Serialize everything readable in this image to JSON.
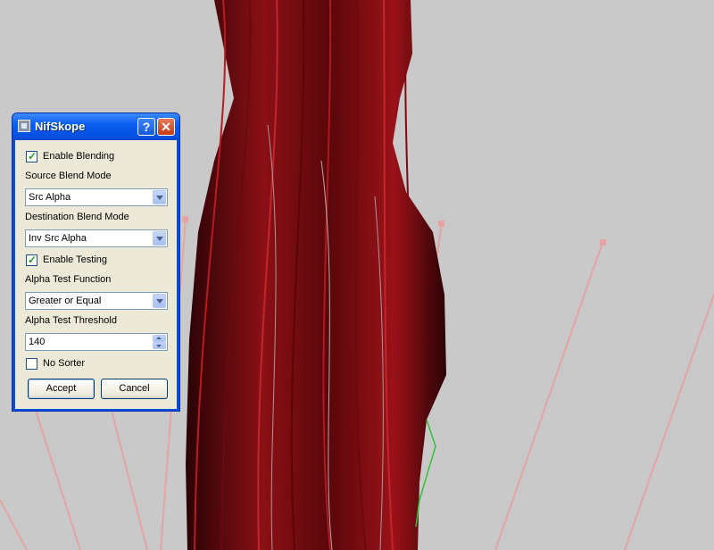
{
  "dialog": {
    "title": "NifSkope",
    "help_glyph": "?",
    "close_glyph": "✕",
    "enable_blending": {
      "label": "Enable Blending",
      "checked": true
    },
    "source_blend_mode": {
      "label": "Source Blend Mode",
      "value": "Src Alpha"
    },
    "destination_blend_mode": {
      "label": "Destination Blend Mode",
      "value": "Inv Src Alpha"
    },
    "enable_testing": {
      "label": "Enable Testing",
      "checked": true
    },
    "alpha_test_function": {
      "label": "Alpha Test Function",
      "value": "Greater or Equal"
    },
    "alpha_test_threshold": {
      "label": "Alpha Test Threshold",
      "value": "140"
    },
    "no_sorter": {
      "label": "No Sorter",
      "checked": false
    },
    "accept_label": "Accept",
    "cancel_label": "Cancel"
  },
  "colors": {
    "viewport_bg": "#c9c9c9",
    "hair_dark": "#3a0508",
    "hair_red": "#9a1218",
    "guide_lines": "#e6a3a3",
    "titlebar": "#0a5ef0"
  },
  "icons": {
    "app": "nifskope-app-icon",
    "help": "help-icon",
    "close": "close-icon",
    "combo_arrow": "chevron-down-icon"
  }
}
